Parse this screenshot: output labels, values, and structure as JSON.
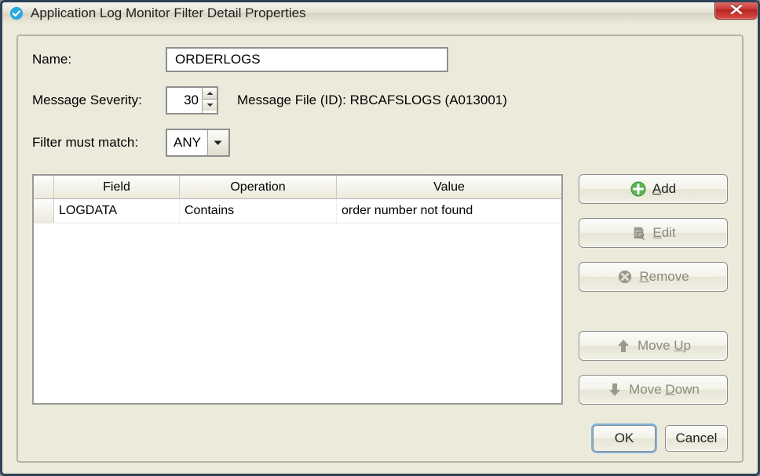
{
  "window_title": "Application Log Monitor Filter Detail Properties",
  "labels": {
    "name": "Name:",
    "severity": "Message Severity:",
    "msgfile_prefix": "Message File (ID):",
    "match": "Filter must match:"
  },
  "values": {
    "name": "ORDERLOGS",
    "severity": "30",
    "msgfile": "RBCAFSLOGS (A013001)",
    "match": "ANY"
  },
  "columns": {
    "c0": "",
    "c1": "Field",
    "c2": "Operation",
    "c3": "Value"
  },
  "rows": [
    {
      "field": "LOGDATA",
      "operation": "Contains",
      "value": "order number not found"
    }
  ],
  "buttons": {
    "add": "Add",
    "edit": "Edit",
    "remove": "Remove",
    "moveup_prefix": "Move ",
    "moveup_key": "U",
    "moveup_suffix": "p",
    "movedown_prefix": "Move ",
    "movedown_key": "D",
    "movedown_suffix": "own",
    "ok": "OK",
    "cancel": "Cancel"
  }
}
